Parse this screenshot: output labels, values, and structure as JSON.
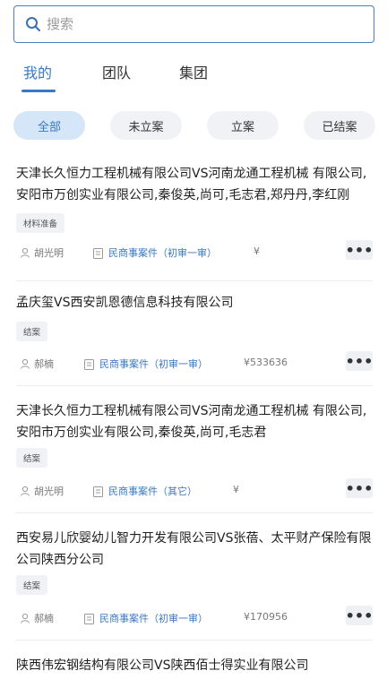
{
  "search": {
    "placeholder": "搜索"
  },
  "tabs": [
    {
      "label": "我的",
      "active": true
    },
    {
      "label": "团队",
      "active": false
    },
    {
      "label": "集团",
      "active": false
    }
  ],
  "filters": [
    {
      "label": "全部",
      "active": true
    },
    {
      "label": "未立案",
      "active": false
    },
    {
      "label": "立案",
      "active": false
    },
    {
      "label": "已结案",
      "active": false
    }
  ],
  "cases": [
    {
      "title": "天津长久恒力工程机械有限公司VS河南龙通工程机械 有限公司,安阳市万创实业有限公司,秦俊英,尚可,毛志君,郑丹丹,李红刚",
      "status": "材料准备",
      "person": "胡光明",
      "type": "民商事案件（初审一审）",
      "amount": "¥"
    },
    {
      "title": "孟庆玺VS西安凯恩德信息科技有限公司",
      "status": "结案",
      "person": "郝楠",
      "type": "民商事案件（初审一审）",
      "amount": "¥533636"
    },
    {
      "title": "天津长久恒力工程机械有限公司VS河南龙通工程机械 有限公司,安阳市万创实业有限公司,秦俊英,尚可,毛志君",
      "status": "结案",
      "person": "胡光明",
      "type": "民商事案件（其它）",
      "amount": "¥"
    },
    {
      "title": "西安易儿欣婴幼儿智力开发有限公司VS张蓓、太平财产保险有限公司陕西分公司",
      "status": "结案",
      "person": "郝楠",
      "type": "民商事案件（初审一审）",
      "amount": "¥170956"
    },
    {
      "title": "陕西伟宏钢结构有限公司VS陕西佰士得实业有限公司",
      "status": "",
      "person": "",
      "type": "",
      "amount": ""
    }
  ],
  "colors": {
    "accent": "#3a78c4",
    "chip_bg": "#f0f2f5",
    "chip_active_bg": "#d6e6f9"
  },
  "icons": {
    "search": "search-icon",
    "person": "person-icon",
    "case_type": "clipboard-icon",
    "more": "more-icon"
  },
  "more_label": "•••"
}
